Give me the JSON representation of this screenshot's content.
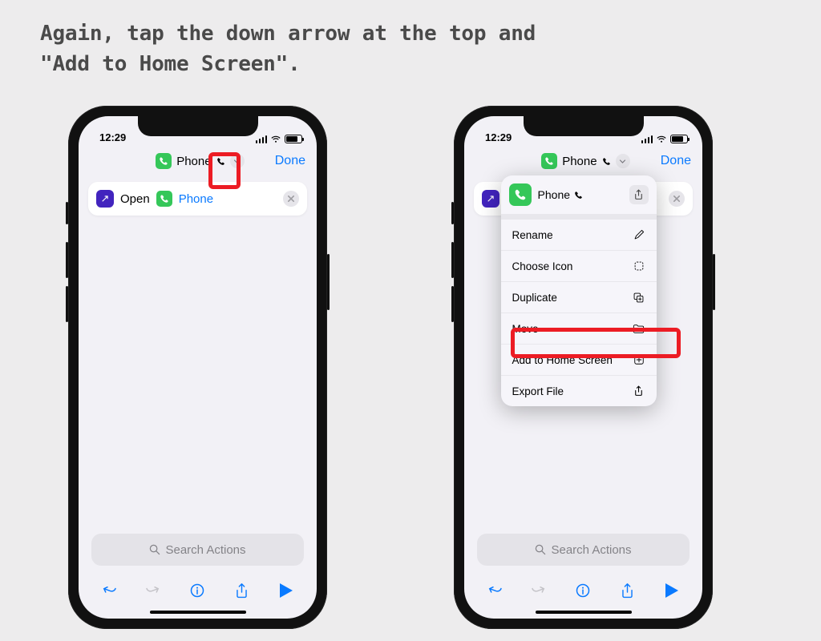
{
  "instruction_line1": "Again, tap the down arrow at the top and",
  "instruction_line2": "\"Add to Home Screen\".",
  "phone": {
    "time": "12:29",
    "title": "Phone",
    "done": "Done",
    "action": {
      "open": "Open",
      "app": "Phone"
    },
    "search_placeholder": "Search Actions"
  },
  "popover": {
    "title": "Phone",
    "items": [
      {
        "label": "Rename"
      },
      {
        "label": "Choose Icon"
      },
      {
        "label": "Duplicate"
      },
      {
        "label": "Move"
      },
      {
        "label": "Add to Home Screen"
      },
      {
        "label": "Export File"
      }
    ]
  }
}
